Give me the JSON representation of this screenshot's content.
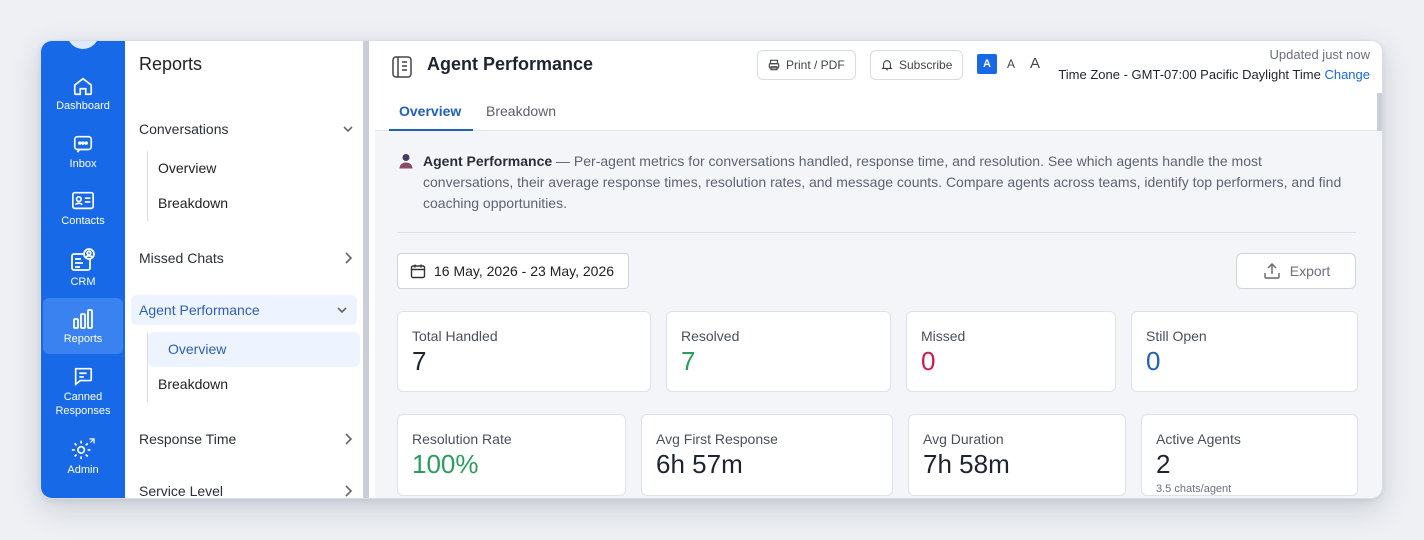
{
  "rail": {
    "items": [
      {
        "label": "Dashboard",
        "icon": "home-icon"
      },
      {
        "label": "Inbox",
        "icon": "chat-icon"
      },
      {
        "label": "Contacts",
        "icon": "contact-card-icon"
      },
      {
        "label": "CRM",
        "icon": "crm-icon"
      },
      {
        "label": "Reports",
        "icon": "bar-chart-icon",
        "active": true
      },
      {
        "label": "Canned Responses",
        "icon": "canned-response-icon"
      },
      {
        "label": "Admin",
        "icon": "gear-icon"
      }
    ],
    "canned_line1": "Canned",
    "canned_line2": "Responses"
  },
  "sidebar": {
    "title": "Reports",
    "conversations": {
      "label": "Conversations",
      "sub": [
        "Overview",
        "Breakdown"
      ]
    },
    "missed": {
      "label": "Missed Chats"
    },
    "agent": {
      "label": "Agent Performance",
      "sub": [
        "Overview",
        "Breakdown"
      ]
    },
    "response": {
      "label": "Response Time"
    },
    "service": {
      "label": "Service Level"
    }
  },
  "header": {
    "title": "Agent Performance",
    "print": "Print / PDF",
    "subscribe": "Subscribe",
    "font_sizes": [
      "A",
      "A",
      "A"
    ],
    "updated": "Updated just now",
    "timezone": "Time Zone - GMT-07:00 Pacific Daylight Time",
    "change": "Change"
  },
  "tabs": {
    "overview": "Overview",
    "breakdown": "Breakdown"
  },
  "description": {
    "title": "Agent Performance",
    "text": " — Per-agent metrics for conversations handled, response time, and resolution. See which agents handle the most conversations, their average response times, resolution rates, and message counts. Compare agents across teams, identify top performers, and find coaching opportunities."
  },
  "date_range": "16 May, 2026 - 23 May, 2026",
  "export": "Export",
  "cards_row1": [
    {
      "label": "Total Handled",
      "value": "7"
    },
    {
      "label": "Resolved",
      "value": "7"
    },
    {
      "label": "Missed",
      "value": "0"
    },
    {
      "label": "Still Open",
      "value": "0"
    }
  ],
  "cards_row2": [
    {
      "label": "Resolution Rate",
      "value": "100%"
    },
    {
      "label": "Avg First Response",
      "value": "6h 57m"
    },
    {
      "label": "Avg Duration",
      "value": "7h 58m"
    },
    {
      "label": "Active Agents",
      "value": "2",
      "sub": "3.5 chats/agent"
    }
  ],
  "colors": {
    "accent": "#1769e8",
    "green": "#2a9d5c",
    "red": "#d11a48",
    "blue": "#1f5fbf"
  }
}
